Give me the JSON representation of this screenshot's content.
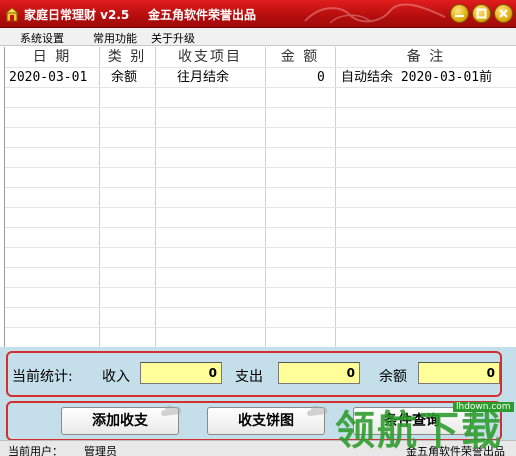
{
  "window": {
    "title": "家庭日常理财 v2.5",
    "subtitle": "金五角软件荣誉出品",
    "controls": [
      "minimize",
      "maximize",
      "close"
    ]
  },
  "menu": {
    "items": [
      "系统设置",
      "常用功能",
      "关于升级"
    ]
  },
  "table": {
    "headers": [
      "日  期",
      "类 别",
      "收支项目",
      "金 额",
      "备  注"
    ],
    "rows": [
      {
        "date": "2020-03-01",
        "category": "余额",
        "item": "往月结余",
        "amount": "0",
        "note": "自动结余 2020-03-01前"
      }
    ]
  },
  "stats": {
    "label": "当前统计:",
    "income_label": "收入",
    "income_value": "0",
    "expense_label": "支出",
    "expense_value": "0",
    "balance_label": "余额",
    "balance_value": "0"
  },
  "buttons": {
    "add": "添加收支",
    "pie": "收支饼图",
    "query": "条件查询"
  },
  "statusbar": {
    "user_label": "当前用户：",
    "user_value": "管理员",
    "right_text": "金五角软件荣誉出品"
  },
  "watermark": {
    "text": "领航下载",
    "url": "lhdown.com"
  },
  "colors": {
    "titlebar": "#c41414",
    "stat_panel": "#c4dfe9",
    "field_bg": "#ffff99",
    "highlight_border": "#d23030"
  }
}
